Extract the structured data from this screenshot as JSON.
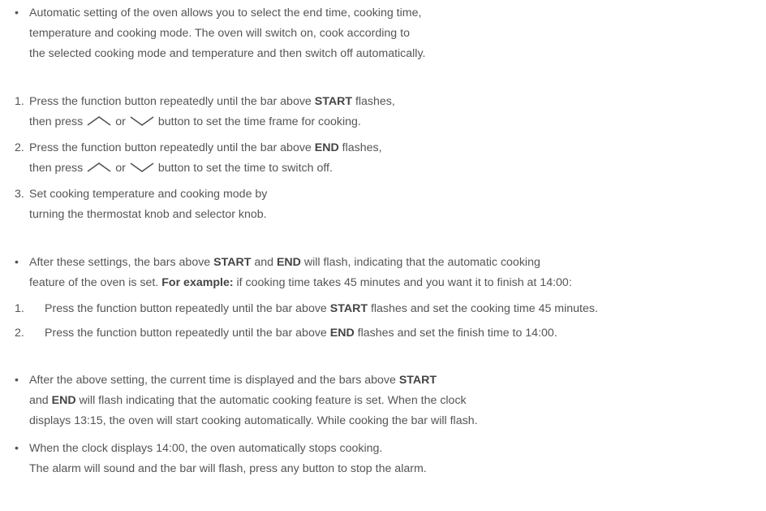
{
  "bullet_1": {
    "marker": "•",
    "lines": [
      "Automatic setting of the oven allows you to select the end time, cooking time,",
      "temperature and cooking mode. The oven will switch on, cook according to",
      "the selected cooking mode and temperature and then switch off automatically."
    ]
  },
  "steps_a": [
    {
      "marker": "1.",
      "l1_pre": "Press the function button repeatedly until the bar above ",
      "l1_bold": "START",
      "l1_post": " flashes,",
      "l2_pre": "then press",
      "l2_mid": "or",
      "l2_post": "button to set the time frame for cooking."
    },
    {
      "marker": "2.",
      "l1_pre": "Press the function button repeatedly until the bar above ",
      "l1_bold": "END",
      "l1_post": " flashes,",
      "l2_pre": "then press",
      "l2_mid": "or",
      "l2_post": "button to set the time to switch off."
    },
    {
      "marker": "3.",
      "l1": "Set cooking temperature and cooking mode by",
      "l2": "turning the thermostat knob and selector knob."
    }
  ],
  "bullet_2": {
    "marker": "•",
    "l1_pre": "After these settings, the bars above ",
    "l1_bold1": "START",
    "l1_mid": " and ",
    "l1_bold2": "END",
    "l1_post": " will flash, indicating that the automatic cooking",
    "l2_pre": "feature of the oven is set. ",
    "l2_bold": "For example:",
    "l2_post": " if cooking time takes 45 minutes and you want it to finish at 14:00:"
  },
  "steps_b": [
    {
      "marker": "1.",
      "pre": "Press the function button repeatedly until the bar above ",
      "bold": "START",
      "post": " flashes and set the cooking time 45 minutes."
    },
    {
      "marker": "2.",
      "pre": "Press the function button repeatedly until the bar above ",
      "bold": "END",
      "post": " flashes and set the finish time to 14:00."
    }
  ],
  "bullet_3": {
    "marker": "•",
    "l1_pre": "After the above setting, the current time is displayed and the bars above ",
    "l1_bold": "START",
    "l2_pre": "and ",
    "l2_bold": "END",
    "l2_post": " will flash indicating that the automatic cooking feature is set. When the clock",
    "l3": "displays 13:15, the oven will start cooking automatically. While cooking the bar will flash."
  },
  "bullet_4": {
    "marker": "•",
    "l1": "When the clock displays 14:00, the oven automatically stops cooking.",
    "l2": "The alarm will sound and the bar will flash, press any button to stop the alarm."
  },
  "icons": {
    "up": "chevron-up-icon",
    "down": "chevron-down-icon"
  }
}
